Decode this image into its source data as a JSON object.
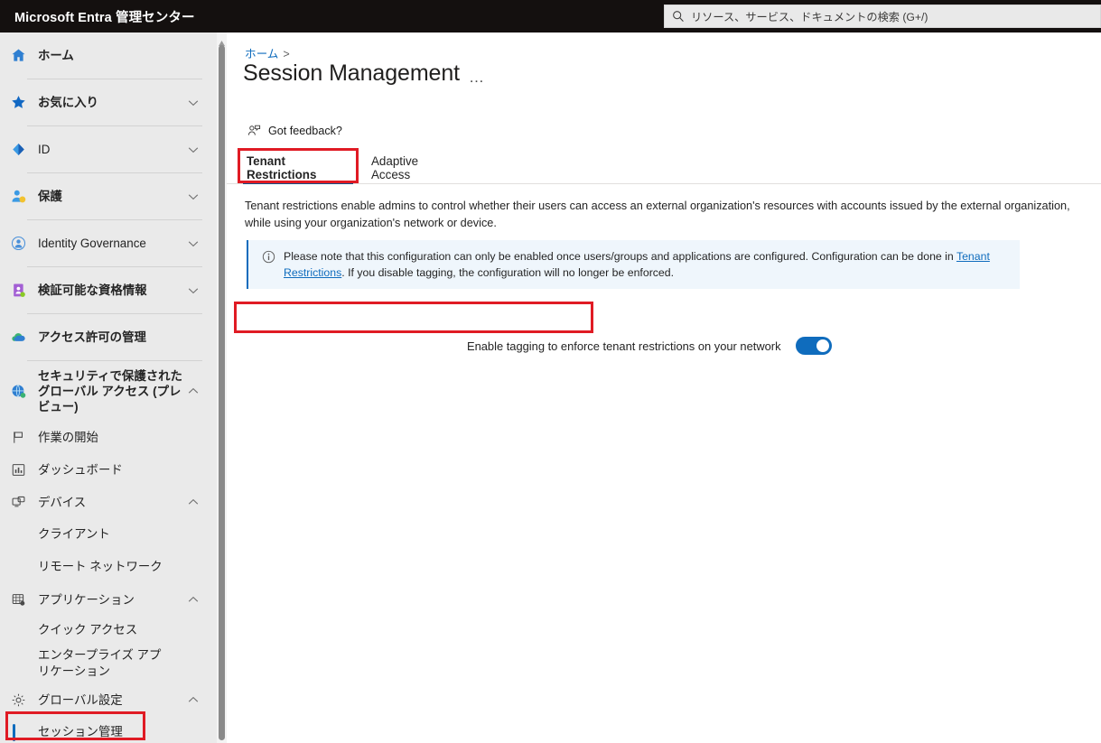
{
  "header": {
    "brand": "Microsoft Entra 管理センター",
    "search": {
      "placeholder": "リソース、サービス、ドキュメントの検索 (G+/)",
      "icon": "search-icon"
    }
  },
  "sidebar": {
    "items": [
      {
        "label": "ホーム",
        "icon": "home-icon",
        "bold": true,
        "chevron": "",
        "sep_after": true
      },
      {
        "label": "お気に入り",
        "icon": "star-icon",
        "bold": true,
        "chevron": "down",
        "sep_after": true
      },
      {
        "label": "ID",
        "icon": "id-diamond-icon",
        "bold": false,
        "chevron": "down",
        "sep_after": true
      },
      {
        "label": "保護",
        "icon": "protection-person-shield-icon",
        "bold": true,
        "chevron": "down",
        "sep_after": true
      },
      {
        "label": "Identity Governance",
        "icon": "identity-governance-icon",
        "bold": false,
        "chevron": "down",
        "sep_after": true
      },
      {
        "label": "検証可能な資格情報",
        "icon": "verifiable-credentials-icon",
        "bold": true,
        "chevron": "down",
        "sep_after": true
      },
      {
        "label": "アクセス許可の管理",
        "icon": "permissions-cloud-icon",
        "bold": true,
        "chevron": "",
        "sep_after": true
      },
      {
        "label": "セキュリティで保護されたグローバル アクセス (プレビュー)",
        "icon": "global-secure-access-globe-icon",
        "bold": true,
        "chevron": "up",
        "sep_after": false
      }
    ],
    "sub_items": [
      {
        "label": "作業の開始",
        "icon": "flag-icon",
        "chevron": "",
        "indent": false,
        "selected": false
      },
      {
        "label": "ダッシュボード",
        "icon": "dashboard-chart-icon",
        "chevron": "",
        "indent": false,
        "selected": false
      },
      {
        "label": "デバイス",
        "icon": "devices-icon",
        "chevron": "up",
        "indent": false,
        "selected": false
      },
      {
        "label": "クライアント",
        "icon": "",
        "chevron": "",
        "indent": true,
        "selected": false
      },
      {
        "label": "リモート ネットワーク",
        "icon": "",
        "chevron": "",
        "indent": true,
        "selected": false
      },
      {
        "label": "アプリケーション",
        "icon": "applications-grid-icon",
        "chevron": "up",
        "indent": false,
        "selected": false
      },
      {
        "label": "クイック アクセス",
        "icon": "",
        "chevron": "",
        "indent": true,
        "selected": false
      },
      {
        "label": "エンタープライズ アプリケーション",
        "icon": "",
        "chevron": "",
        "indent": true,
        "selected": false
      },
      {
        "label": "グローバル設定",
        "icon": "gear-icon",
        "chevron": "up",
        "indent": false,
        "selected": false
      },
      {
        "label": "セッション管理",
        "icon": "",
        "chevron": "",
        "indent": true,
        "selected": true
      }
    ]
  },
  "content": {
    "breadcrumb": {
      "home": "ホーム",
      "separator": ">"
    },
    "title": "Session Management",
    "title_more": "…",
    "feedback_label": "Got feedback?",
    "tabs": [
      {
        "label": "Tenant Restrictions",
        "active": true
      },
      {
        "label": "Adaptive Access",
        "active": false
      }
    ],
    "description": "Tenant restrictions enable admins to control whether their users can access an external organization's resources with accounts issued by the external organization, while using your organization's network or device.",
    "info": {
      "text_before": "Please note that this configuration can only be enabled once users/groups and applications are configured. Configuration can be done in ",
      "link": "Tenant Restrictions",
      "text_after": ". If you disable tagging, the configuration will no longer be enforced.",
      "icon": "info-circle-icon"
    },
    "toggle": {
      "label": "Enable tagging to enforce tenant restrictions on your network",
      "state": "on"
    }
  },
  "colors": {
    "brand_blue": "#0f6cbd",
    "tab_underline": "#0f548c",
    "annotation_red": "#e01b24",
    "header_dark": "#14100f",
    "sidebar_bg": "#eaeaea",
    "info_bg": "#eff6fc"
  }
}
